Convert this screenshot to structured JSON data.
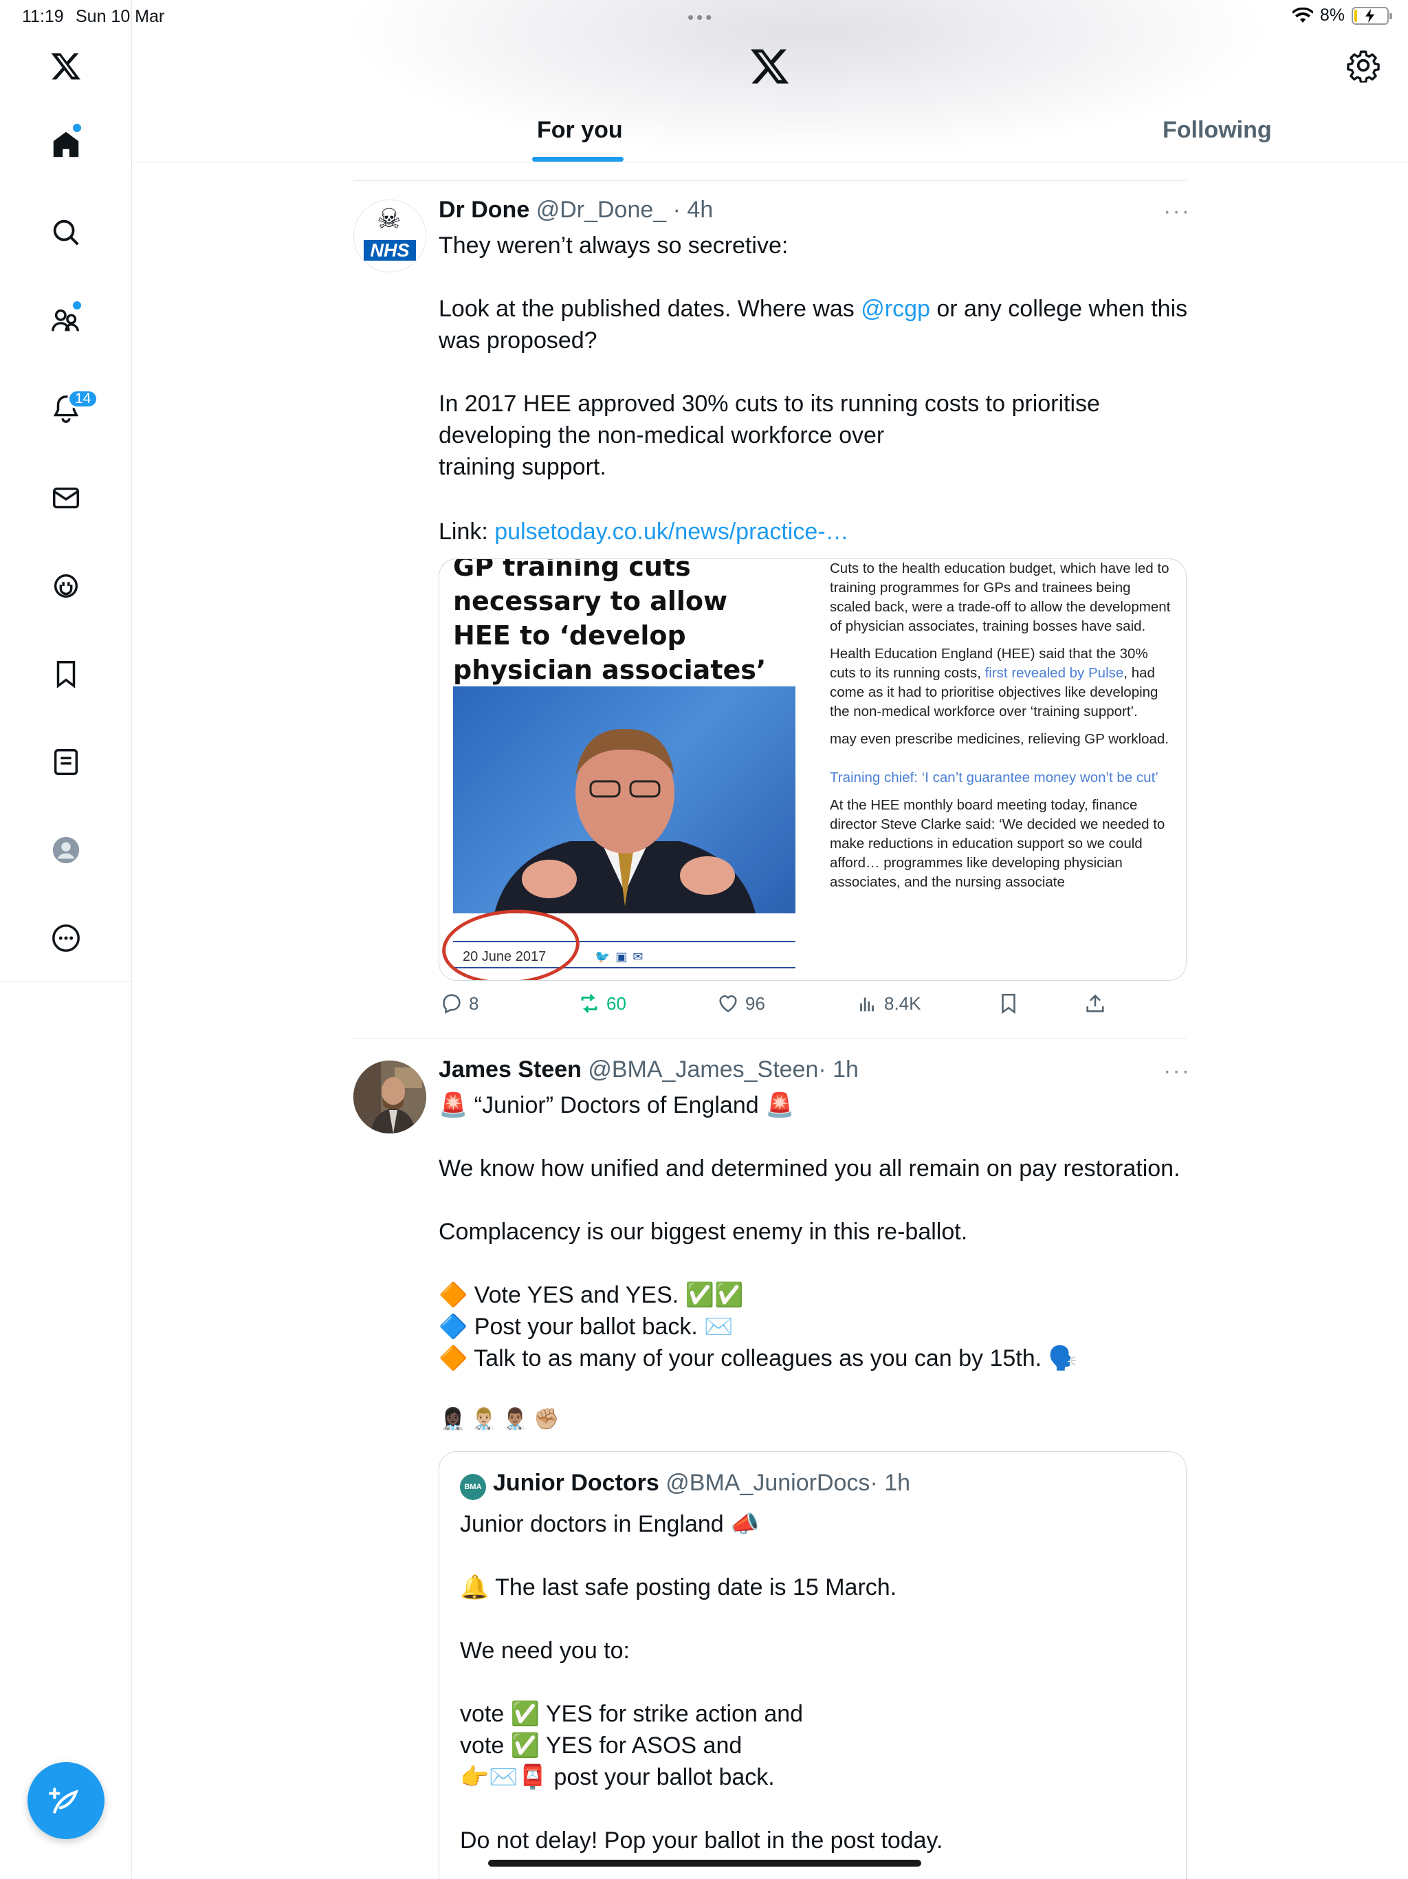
{
  "status_bar": {
    "time": "11:19",
    "date": "Sun 10 Mar",
    "battery": "8%",
    "battery_level": 0.08
  },
  "sidebar": {
    "notifications_badge": "14",
    "items": [
      "x-logo",
      "home",
      "explore",
      "communities",
      "notifications",
      "messages",
      "grok",
      "bookmarks",
      "lists",
      "profile",
      "more"
    ]
  },
  "tabs": [
    {
      "label": "For you",
      "active": true
    },
    {
      "label": "Following",
      "active": false
    }
  ],
  "tweets": [
    {
      "name": "Dr Done",
      "handle": "@Dr_Done_",
      "time": "· 4h",
      "text_1": "They weren’t always so secretive:",
      "text_2a": "Look at the published dates. Where was ",
      "mention": "@rcgp",
      "text_2b": " or any college when this was proposed?",
      "text_3": "In 2017 HEE approved 30% cuts to its running costs to prioritise\ndeveloping the non-medical workforce over\ntraining support.",
      "link_prefix": "Link: ",
      "link": "pulsetoday.co.uk/news/practice-…",
      "media": {
        "headline": "GP training cuts necessary to allow HEE to ‘develop physician associates’",
        "date": "20 June 2017",
        "para1": "Cuts to the health education budget, which have led to training programmes for GPs and trainees being scaled back, were a trade-off to allow the development of physician associates, training bosses have said.",
        "para2a": "Health Education England (HEE) said that the 30% cuts to its running costs, ",
        "para2_link": "first revealed by Pulse",
        "para2b": ", had come as it had to prioritise objectives like developing the non-medical workforce over ‘training support’.",
        "para3": "may even prescribe medicines, relieving GP workload.",
        "related": "Training chief: ‘I can’t guarantee money won’t be cut’",
        "para4": "At the HEE monthly board meeting today, finance director Steve Clarke said: ‘We decided we needed to make reductions in education support so we could afford… programmes like developing physician associates, and the nursing associate"
      },
      "stats": {
        "replies": "8",
        "reposts": "60",
        "likes": "96",
        "views": "8.4K"
      }
    },
    {
      "name": "James Steen",
      "handle": "@BMA_James_Steen",
      "time": "· 1h",
      "text": "🚨 “Junior” Doctors of England 🚨\n\nWe know how unified and determined you all remain on pay restoration.\n\nComplacency is our biggest enemy in this re-ballot.\n\n🔶 Vote YES and YES. ✅✅\n🔷 Post your ballot back. ✉️\n🔶 Talk to as many of your colleagues as you can by 15th. 🗣️",
      "emojis": "👩🏿‍⚕️👨🏼‍⚕️👨🏽‍⚕️✊🏼",
      "quote": {
        "avatar_text": "BMA",
        "name": "Junior Doctors",
        "handle": "@BMA_JuniorDocs",
        "time": "· 1h",
        "text": "Junior doctors in England 📣\n\n🔔 The last safe posting date is 15 March.\n\nWe need you to:\n\nvote ✅ YES for strike action and\nvote ✅ YES for ASOS and\n👉✉️📮 post your ballot back.\n\nDo not delay! Pop your ballot in the post today."
      }
    }
  ],
  "colors": {
    "accent": "#1d9bf0",
    "repost": "#00ba7c",
    "text": "#0f1419",
    "muted": "#536471"
  }
}
